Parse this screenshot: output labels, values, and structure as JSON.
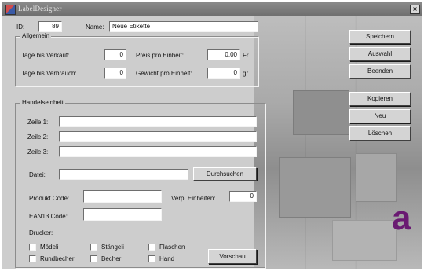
{
  "window": {
    "title": "LabelDesigner",
    "close_glyph": "×",
    "app_icon": "app-icon"
  },
  "header": {
    "id_label": "ID:",
    "id_value": "89",
    "name_label": "Name:",
    "name_value": "Neue Etikette"
  },
  "allgemein": {
    "title": "Allgemein",
    "tage_verkauf_label": "Tage bis Verkauf:",
    "tage_verkauf_value": "0",
    "tage_verbrauch_label": "Tage bis Verbrauch:",
    "tage_verbrauch_value": "0",
    "preis_label": "Preis pro Einheit:",
    "preis_value": "0.00",
    "preis_unit": "Fr.",
    "gewicht_label": "Gewicht pro Einheit:",
    "gewicht_value": "0",
    "gewicht_unit": "gr."
  },
  "handelseinheit": {
    "title": "Handelseinheit",
    "zeile1_label": "Zeile 1:",
    "zeile1_value": "",
    "zeile2_label": "Zeile 2:",
    "zeile2_value": "",
    "zeile3_label": "Zeile 3:",
    "zeile3_value": "",
    "datei_label": "Datei:",
    "datei_value": "",
    "durchsuchen_label": "Durchsuchen",
    "produkt_code_label": "Produkt Code:",
    "produkt_code_value": "",
    "verp_einheiten_label": "Verp. Einheiten:",
    "verp_einheiten_value": "0",
    "ean13_label": "EAN13 Code:",
    "ean13_value": "",
    "drucker_label": "Drucker:",
    "checkboxes": {
      "moedeli": "Mödeli",
      "staengeli": "Stängeli",
      "flaschen": "Flaschen",
      "rundbecher": "Rundbecher",
      "becher": "Becher",
      "hand": "Hand"
    },
    "vorschau_label": "Vorschau"
  },
  "buttons": {
    "speichern": "Speichern",
    "auswahl": "Auswahl",
    "beenden": "Beenden",
    "kopieren": "Kopieren",
    "neu": "Neu",
    "loeschen": "Löschen"
  },
  "background": {
    "letter": "a",
    "accent_color": "#6a1a72"
  }
}
